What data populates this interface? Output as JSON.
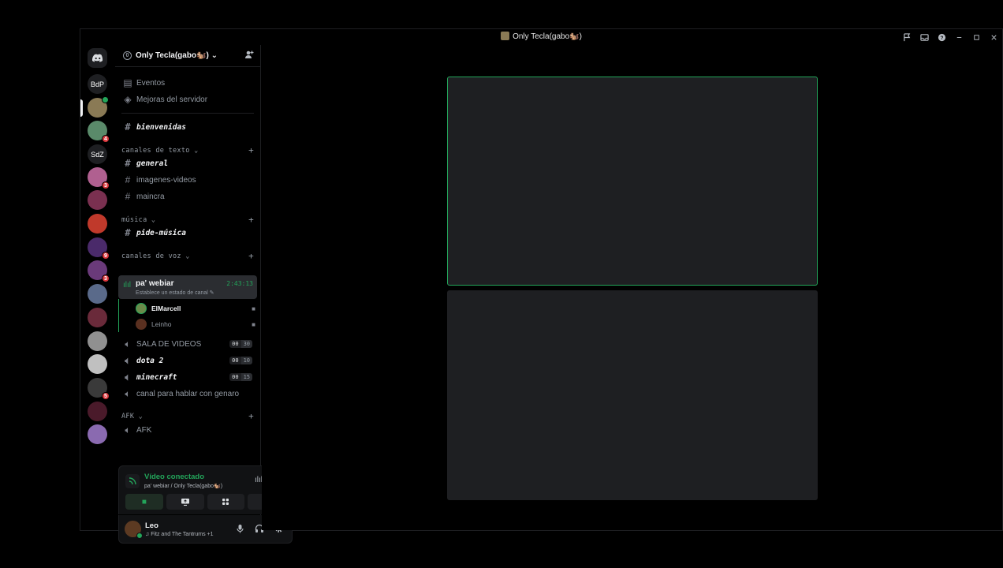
{
  "window": {
    "title": "Only Tecla(gabo🐿️)",
    "controls": [
      "flag-icon",
      "inbox-icon",
      "help-icon",
      "minimize",
      "maximize",
      "close"
    ]
  },
  "rail": {
    "items": [
      {
        "label": "",
        "icon": "discord-home-icon",
        "color": "#1e1f22"
      },
      {
        "label": "BdP",
        "color": "#1e1f22"
      },
      {
        "label": "",
        "color": "#8a7a55",
        "active": true,
        "online": true
      },
      {
        "label": "",
        "color": "#5a8a6a",
        "badge": "4"
      },
      {
        "label": "SdZ",
        "color": "#1e1f22"
      },
      {
        "label": "",
        "color": "#b06090",
        "badge": "3"
      },
      {
        "label": "",
        "color": "#7a3050"
      },
      {
        "label": "",
        "color": "#c0392b"
      },
      {
        "label": "",
        "color": "#4a2a6a",
        "badge": "9"
      },
      {
        "label": "",
        "color": "#6a3a7a",
        "badge": "3"
      },
      {
        "label": "",
        "color": "#5a6a8a"
      },
      {
        "label": "",
        "color": "#6a2a3a"
      },
      {
        "label": "",
        "color": "#909090"
      },
      {
        "label": "",
        "color": "#c0c0c0"
      },
      {
        "label": "",
        "color": "#3a3a3a",
        "badge": "5"
      },
      {
        "label": "",
        "color": "#4a1a2a"
      },
      {
        "label": "",
        "color": "#8a6ab0"
      }
    ]
  },
  "sidebar": {
    "server_name": "Only Tecla(gabo🐿️)",
    "boost_level": "0",
    "events": "Eventos",
    "boosts": "Mejoras del servidor",
    "welcome": "bienvenidas",
    "cat_text": "canales de texto",
    "text_channels": [
      "general",
      "imagenes-videos",
      "maincra"
    ],
    "cat_music": "música",
    "music_channel": "pide-música",
    "cat_voice": "canales de voz",
    "active_voice": {
      "name": "pa' webiar",
      "status": "Establece un estado de canal",
      "time": "2:43:13"
    },
    "voice_users": [
      {
        "name": "ElMarcell",
        "color": "#6a8a4a"
      },
      {
        "name": "Leinho",
        "color": "#5a3020"
      }
    ],
    "voice_channels": [
      {
        "name": "SALA DE VIDEOS",
        "a": "00",
        "b": "30"
      },
      {
        "name": "dota 2",
        "a": "00",
        "b": "10"
      },
      {
        "name": "minecraft",
        "a": "00",
        "b": "15"
      }
    ],
    "voice_extra": "canal para hablar con genaro",
    "cat_afk": "AFK",
    "afk_channel": "AFK"
  },
  "voice_panel": {
    "title": "Vídeo conectado",
    "subtitle": "pa' webiar / Only Tecla(gabo🐿️)"
  },
  "user_panel": {
    "name": "Leo",
    "activity": "Fitz and The Tantrums +1"
  }
}
